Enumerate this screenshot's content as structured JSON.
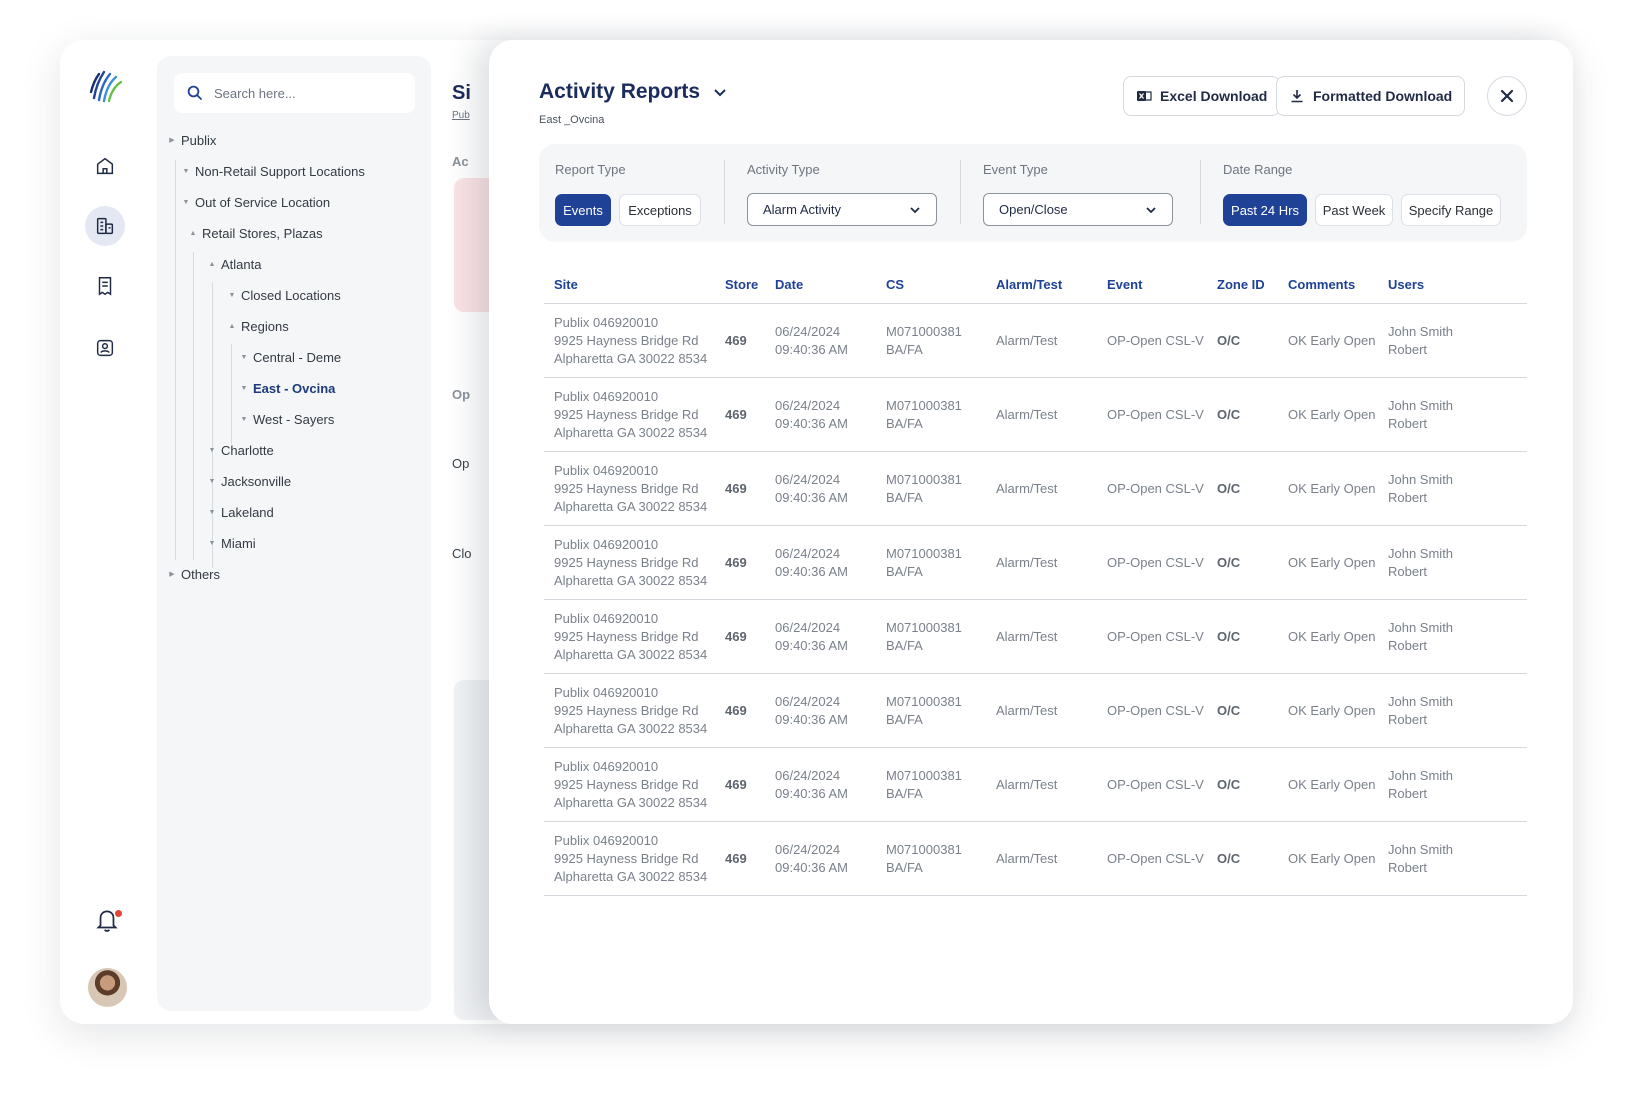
{
  "search": {
    "placeholder": "Search here..."
  },
  "tree": {
    "publix": "Publix",
    "non_retail": "Non-Retail Support Locations",
    "out_of_service": "Out of Service Location",
    "retail_stores": "Retail Stores, Plazas",
    "atlanta": "Atlanta",
    "closed_locations": "Closed Locations",
    "regions": "Regions",
    "central": "Central - Deme",
    "east": "East - Ovcina",
    "west": "West - Sayers",
    "charlotte": "Charlotte",
    "jacksonville": "Jacksonville",
    "lakeland": "Lakeland",
    "miami": "Miami",
    "others": "Others"
  },
  "under_page": {
    "title": "Si",
    "sub": "Pub",
    "label1": "Ac",
    "label2": "Op",
    "label3": "Op",
    "label4": "Clo"
  },
  "modal": {
    "title": "Activity Reports",
    "subtitle": "East _Ovcina",
    "excel_label": "Excel Download",
    "formatted_label": "Formatted Download"
  },
  "filters": {
    "report_type": {
      "label": "Report Type",
      "options": [
        "Events",
        "Exceptions"
      ],
      "selected": "Events"
    },
    "activity_type": {
      "label": "Activity Type",
      "value": "Alarm Activity"
    },
    "event_type": {
      "label": "Event Type",
      "value": "Open/Close"
    },
    "date_range": {
      "label": "Date Range",
      "options": [
        "Past 24 Hrs",
        "Past Week",
        "Specify Range"
      ],
      "selected": "Past 24 Hrs"
    }
  },
  "table": {
    "headers": [
      "Site",
      "Store",
      "Date",
      "CS",
      "Alarm/Test",
      "Event",
      "Zone ID",
      "Comments",
      "Users"
    ],
    "rows": [
      {
        "site1": "Publix 046920010",
        "site2": "9925 Hayness Bridge Rd",
        "site3": "Alpharetta GA 30022 8534",
        "store": "469",
        "date1": "06/24/2024",
        "date2": "09:40:36 AM",
        "cs1": "M071000381",
        "cs2": "BA/FA",
        "alarm": "Alarm/Test",
        "event": "OP-Open CSL-V",
        "zone": "O/C",
        "comments": "OK Early Open",
        "users1": "John Smith",
        "users2": "Robert"
      },
      {
        "site1": "Publix 046920010",
        "site2": "9925 Hayness Bridge Rd",
        "site3": "Alpharetta GA 30022 8534",
        "store": "469",
        "date1": "06/24/2024",
        "date2": "09:40:36 AM",
        "cs1": "M071000381",
        "cs2": "BA/FA",
        "alarm": "Alarm/Test",
        "event": "OP-Open CSL-V",
        "zone": "O/C",
        "comments": "OK Early Open",
        "users1": "John Smith",
        "users2": "Robert"
      },
      {
        "site1": "Publix 046920010",
        "site2": "9925 Hayness Bridge Rd",
        "site3": "Alpharetta GA 30022 8534",
        "store": "469",
        "date1": "06/24/2024",
        "date2": "09:40:36 AM",
        "cs1": "M071000381",
        "cs2": "BA/FA",
        "alarm": "Alarm/Test",
        "event": "OP-Open CSL-V",
        "zone": "O/C",
        "comments": "OK Early Open",
        "users1": "John Smith",
        "users2": "Robert"
      },
      {
        "site1": "Publix 046920010",
        "site2": "9925 Hayness Bridge Rd",
        "site3": "Alpharetta GA 30022 8534",
        "store": "469",
        "date1": "06/24/2024",
        "date2": "09:40:36 AM",
        "cs1": "M071000381",
        "cs2": "BA/FA",
        "alarm": "Alarm/Test",
        "event": "OP-Open CSL-V",
        "zone": "O/C",
        "comments": "OK Early Open",
        "users1": "John Smith",
        "users2": "Robert"
      },
      {
        "site1": "Publix 046920010",
        "site2": "9925 Hayness Bridge Rd",
        "site3": "Alpharetta GA 30022 8534",
        "store": "469",
        "date1": "06/24/2024",
        "date2": "09:40:36 AM",
        "cs1": "M071000381",
        "cs2": "BA/FA",
        "alarm": "Alarm/Test",
        "event": "OP-Open CSL-V",
        "zone": "O/C",
        "comments": "OK Early Open",
        "users1": "John Smith",
        "users2": "Robert"
      },
      {
        "site1": "Publix 046920010",
        "site2": "9925 Hayness Bridge Rd",
        "site3": "Alpharetta GA 30022 8534",
        "store": "469",
        "date1": "06/24/2024",
        "date2": "09:40:36 AM",
        "cs1": "M071000381",
        "cs2": "BA/FA",
        "alarm": "Alarm/Test",
        "event": "OP-Open CSL-V",
        "zone": "O/C",
        "comments": "OK Early Open",
        "users1": "John Smith",
        "users2": "Robert"
      },
      {
        "site1": "Publix 046920010",
        "site2": "9925 Hayness Bridge Rd",
        "site3": "Alpharetta GA 30022 8534",
        "store": "469",
        "date1": "06/24/2024",
        "date2": "09:40:36 AM",
        "cs1": "M071000381",
        "cs2": "BA/FA",
        "alarm": "Alarm/Test",
        "event": "OP-Open CSL-V",
        "zone": "O/C",
        "comments": "OK Early Open",
        "users1": "John Smith",
        "users2": "Robert"
      },
      {
        "site1": "Publix 046920010",
        "site2": "9925 Hayness Bridge Rd",
        "site3": "Alpharetta GA 30022 8534",
        "store": "469",
        "date1": "06/24/2024",
        "date2": "09:40:36 AM",
        "cs1": "M071000381",
        "cs2": "BA/FA",
        "alarm": "Alarm/Test",
        "event": "OP-Open CSL-V",
        "zone": "O/C",
        "comments": "OK Early Open",
        "users1": "John Smith",
        "users2": "Robert"
      }
    ]
  },
  "colors": {
    "primary": "#1f4196",
    "title": "#1a2b5c",
    "notification_dot": "#e0443a"
  }
}
